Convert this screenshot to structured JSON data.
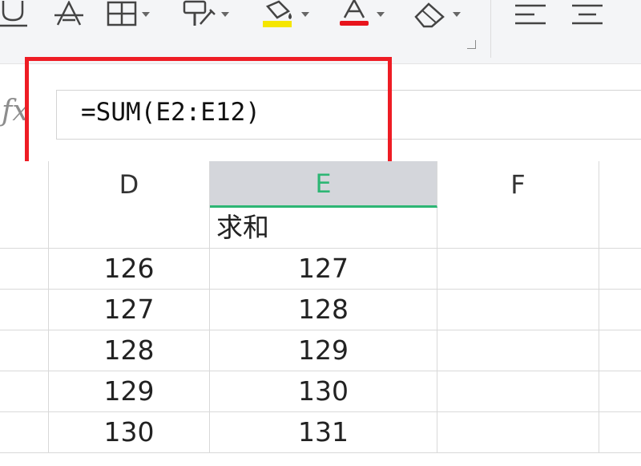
{
  "toolbar": {
    "buttons": [
      {
        "name": "underline-button",
        "icon": "underline-icon",
        "has_dropdown": false
      },
      {
        "name": "strikethrough-button",
        "icon": "strikethrough-icon",
        "has_dropdown": false
      },
      {
        "name": "borders-button",
        "icon": "borders-icon",
        "has_dropdown": true
      },
      {
        "name": "format-painter-button",
        "icon": "format-painter-icon",
        "has_dropdown": true
      },
      {
        "name": "fill-color-button",
        "icon": "fill-color-icon",
        "has_dropdown": true,
        "color": "#f5e600"
      },
      {
        "name": "font-color-button",
        "icon": "font-color-icon",
        "has_dropdown": true,
        "color": "#e8141c"
      },
      {
        "name": "clear-button",
        "icon": "eraser-icon",
        "has_dropdown": true
      },
      {
        "name": "align-left-button",
        "icon": "align-left-icon",
        "has_dropdown": false
      },
      {
        "name": "align-center-button",
        "icon": "align-center-icon",
        "has_dropdown": false
      }
    ]
  },
  "formula_bar": {
    "fx_label": "fx",
    "formula": "=SUM(E2:E12)"
  },
  "highlight": {
    "color": "#ee1c24"
  },
  "columns": [
    {
      "label": "D",
      "active": false
    },
    {
      "label": "E",
      "active": true
    },
    {
      "label": "F",
      "active": false
    }
  ],
  "colors": {
    "active_column_accent": "#2db674",
    "active_column_bg": "#d4d6db",
    "grid_line": "#d9d9d9"
  },
  "rows": [
    {
      "d": "",
      "e": "求和",
      "f": ""
    },
    {
      "d": "126",
      "e": "127",
      "f": ""
    },
    {
      "d": "127",
      "e": "128",
      "f": ""
    },
    {
      "d": "128",
      "e": "129",
      "f": ""
    },
    {
      "d": "129",
      "e": "130",
      "f": ""
    },
    {
      "d": "130",
      "e": "131",
      "f": ""
    }
  ]
}
